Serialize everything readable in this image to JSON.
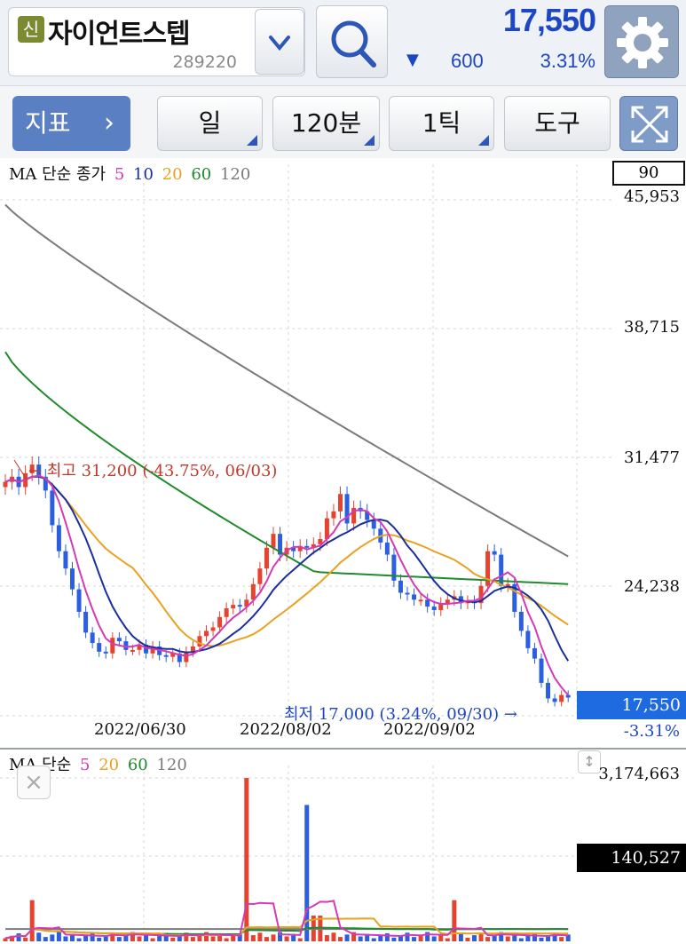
{
  "header": {
    "badge": "신",
    "stock_name": "자이언트스텝",
    "stock_code": "289220",
    "price": "17,550",
    "change_arrow": "▼",
    "change": "600",
    "change_pct": "3.31%"
  },
  "toolbar": {
    "indicator_label": "지표",
    "indicator_chevron": "›",
    "period": "일",
    "interval": "120분",
    "tick": "1틱",
    "tools": "도구"
  },
  "price_chart": {
    "legend_prefix": "MA 단순 종가",
    "ma_labels": [
      "5",
      "10",
      "20",
      "60",
      "120"
    ],
    "box_label": "90",
    "price_labels": [
      "45,953",
      "38,715",
      "31,477",
      "24,238"
    ],
    "date_labels": [
      "2022/06/30",
      "2022/08/02",
      "2022/09/02"
    ],
    "high_annotation": "← 최고 31,200 (-43.75%, 06/03)",
    "low_annotation": "최저 17,000 (3.24%, 09/30) →",
    "current_price": "17,550",
    "current_pct": "-3.31%"
  },
  "volume_chart": {
    "legend_prefix": "MA 단순",
    "ma_labels": [
      "5",
      "20",
      "60",
      "120"
    ],
    "top_label": "3,174,663",
    "current_volume": "140,527",
    "close_glyph": "×",
    "scroll_glyph": "↕"
  },
  "colors": {
    "ma5": "#d43ab5",
    "ma10": "#1a2f9e",
    "ma20": "#e9a21f",
    "ma60": "#1f8a2e",
    "ma120": "#7a7a7a",
    "up": "#e5432f",
    "down": "#2c5fe0",
    "accent": "#1d46c4"
  },
  "chart_data": {
    "type": "candlestick",
    "period": "daily",
    "y_range": [
      16500,
      47000
    ],
    "candles_approx_close": [
      30000,
      30300,
      29700,
      30500,
      31000,
      30300,
      29500,
      27500,
      26000,
      25000,
      23800,
      22500,
      21300,
      20700,
      20200,
      20100,
      21000,
      20800,
      20300,
      20300,
      20600,
      20100,
      20500,
      20000,
      19900,
      20100,
      19600,
      20200,
      20500,
      21100,
      21400,
      21600,
      22200,
      22700,
      22900,
      22800,
      23200,
      24100,
      25000,
      26200,
      27000,
      25800,
      26200,
      26000,
      26300,
      26200,
      26400,
      26700,
      27900,
      28300,
      29300,
      27600,
      28500,
      28300,
      27800,
      27300,
      26500,
      25800,
      24300,
      23600,
      23500,
      23200,
      23200,
      22800,
      22600,
      23000,
      23200,
      23400,
      23000,
      23100,
      23000,
      24000,
      26000,
      25800,
      24000,
      24100,
      22500,
      21400,
      20400,
      19800,
      18400,
      17500,
      17300,
      17700,
      17550
    ],
    "moving_averages": [
      {
        "name": "5",
        "values_approx": "follows close with short lag"
      },
      {
        "name": "10",
        "values_approx": "follows close with medium lag"
      },
      {
        "name": "20",
        "values_approx": "smoothed"
      },
      {
        "name": "60",
        "values_approx": "declining from ~38000 to ~24200"
      },
      {
        "name": "120",
        "values_approx": "declining from ~46000 to ~25700"
      }
    ],
    "volume_ylim": [
      0,
      3174663
    ],
    "volume_current": 140527
  }
}
